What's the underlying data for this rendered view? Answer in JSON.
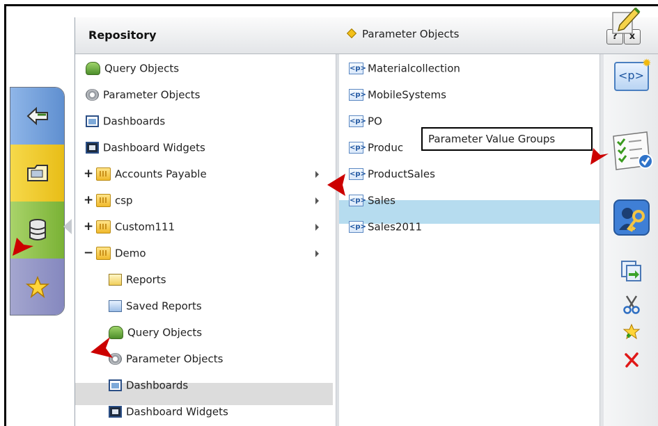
{
  "header": {
    "title": "Repository",
    "breadcrumb": "Parameter Objects",
    "help_label": "?",
    "close_label": "x"
  },
  "tree": {
    "items": [
      {
        "label": "Query Objects",
        "icon": "query-objects-icon"
      },
      {
        "label": "Parameter Objects",
        "icon": "parameter-objects-icon"
      },
      {
        "label": "Dashboards",
        "icon": "dashboards-icon"
      },
      {
        "label": "Dashboard Widgets",
        "icon": "dashboard-widgets-icon"
      },
      {
        "label": "Accounts Payable",
        "icon": "folder-icon",
        "expander": "+"
      },
      {
        "label": "csp",
        "icon": "folder-icon",
        "expander": "+"
      },
      {
        "label": "Custom111",
        "icon": "folder-icon",
        "expander": "+"
      },
      {
        "label": "Demo",
        "icon": "folder-icon",
        "expander": "−"
      },
      {
        "label": "Reports",
        "icon": "reports-icon"
      },
      {
        "label": "Saved Reports",
        "icon": "saved-reports-icon"
      },
      {
        "label": "Query Objects",
        "icon": "query-objects-icon"
      },
      {
        "label": "Parameter Objects",
        "icon": "parameter-objects-icon"
      },
      {
        "label": "Dashboards",
        "icon": "dashboards-icon"
      },
      {
        "label": "Dashboard Widgets",
        "icon": "dashboard-widgets-icon"
      }
    ]
  },
  "list": {
    "icon_text": "<p>",
    "items": [
      {
        "label": "Materialcollection"
      },
      {
        "label": "MobileSystems"
      },
      {
        "label": "PO"
      },
      {
        "label": "Produc"
      },
      {
        "label": "ProductSales"
      },
      {
        "label": "Sales"
      },
      {
        "label": "Sales2011"
      }
    ]
  },
  "tooltip": {
    "text": "Parameter Value Groups"
  },
  "tools": {
    "new_param_text": "<p>"
  },
  "colors": {
    "selection": "#b6dcef",
    "annotation_arrow": "#cc0000"
  }
}
